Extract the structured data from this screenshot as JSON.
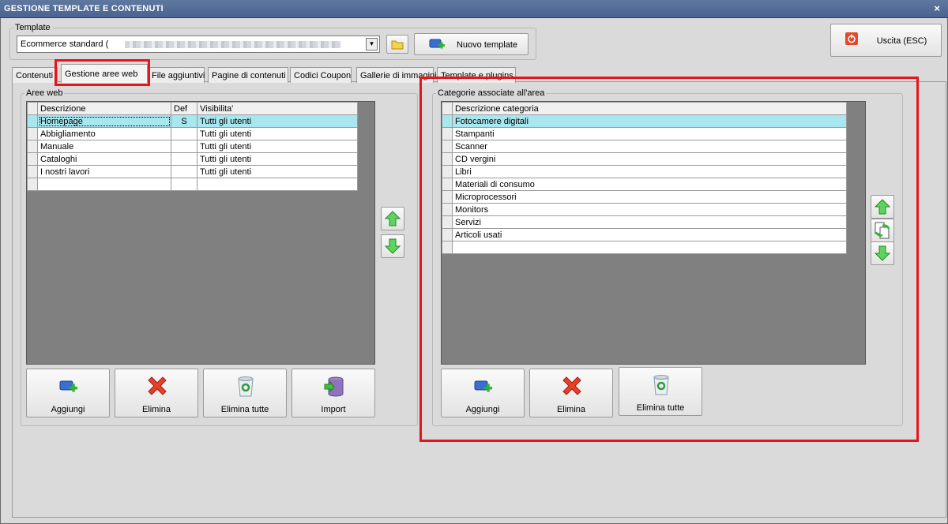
{
  "window": {
    "title": "GESTIONE TEMPLATE E CONTENUTI",
    "close_glyph": "×"
  },
  "template": {
    "legend": "Template",
    "selected": "Ecommerce standard (",
    "new_button": "Nuovo template",
    "exit_button": "Uscita (ESC)"
  },
  "tabs": [
    {
      "label": "Contenuti"
    },
    {
      "label": "Gestione aree web",
      "active": true
    },
    {
      "label": "File aggiuntivi"
    },
    {
      "label": "Pagine di contenuti"
    },
    {
      "label": "Codici Coupon"
    },
    {
      "label": "Gallerie di immagini"
    },
    {
      "label": "Template e plugins"
    }
  ],
  "areas": {
    "legend": "Aree web",
    "columns": [
      "Descrizione",
      "Def",
      "Visibilita'"
    ],
    "rows": [
      {
        "descr": "Homepage",
        "def": "S",
        "vis": "Tutti gli utenti",
        "selected": true
      },
      {
        "descr": "Abbigliamento",
        "def": "",
        "vis": "Tutti gli utenti"
      },
      {
        "descr": "Manuale",
        "def": "",
        "vis": "Tutti gli utenti"
      },
      {
        "descr": "Cataloghi",
        "def": "",
        "vis": "Tutti gli utenti"
      },
      {
        "descr": "I nostri lavori",
        "def": "",
        "vis": "Tutti gli utenti"
      }
    ],
    "buttons": {
      "add": "Aggiungi",
      "delete": "Elimina",
      "delete_all": "Elimina tutte",
      "import": "Import"
    }
  },
  "categories": {
    "legend": "Categorie associate all'area",
    "column": "Descrizione categoria",
    "rows": [
      "Fotocamere digitali",
      "Stampanti",
      "Scanner",
      "CD vergini",
      "Libri",
      "Materiali di consumo",
      "Microprocessori",
      "Monitors",
      "Servizi",
      "Articoli usati"
    ],
    "buttons": {
      "add": "Aggiungi",
      "delete": "Elimina",
      "delete_all": "Elimina tutte"
    }
  },
  "colors": {
    "highlight": "#e2161b",
    "selection": "#a8e6f0",
    "titlebar": "#4a6390"
  }
}
